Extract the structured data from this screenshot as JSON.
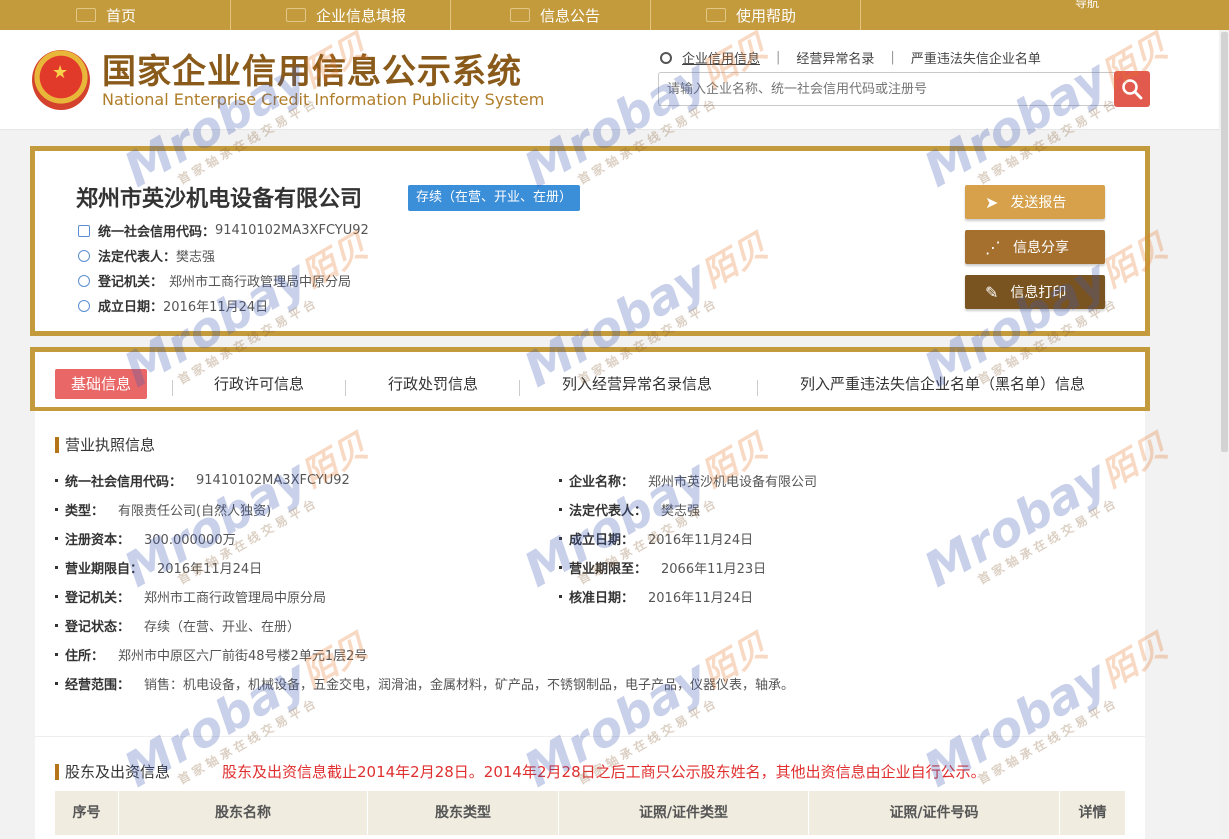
{
  "topnav": {
    "items": [
      "首页",
      "企业信息填报",
      "信息公告",
      "使用帮助"
    ],
    "right": "导航"
  },
  "header": {
    "title": "国家企业信用信息公示系统",
    "subtitle": "National Enterprise Credit Information Publicity System",
    "quicklinks": [
      "企业信用信息",
      "经营异常名录",
      "严重违法失信企业名单"
    ],
    "search_placeholder": "请输入企业名称、统一社会信用代码或注册号"
  },
  "company": {
    "name": "郑州市英沙机电设备有限公司",
    "status": "存续（在营、开业、在册）",
    "credit_code_label": "统一社会信用代码：",
    "credit_code": "91410102MA3XFCYU92",
    "legal_rep_label": "法定代表人：",
    "legal_rep": "樊志强",
    "authority_label": "登记机关：",
    "authority": "郑州市工商行政管理局中原分局",
    "founded_label": "成立日期：",
    "founded": "2016年11月24日"
  },
  "actions": [
    "发送报告",
    "信息分享",
    "信息打印"
  ],
  "tabs": [
    "基础信息",
    "行政许可信息",
    "行政处罚信息",
    "列入经营异常名录信息",
    "列入严重违法失信企业名单（黑名单）信息"
  ],
  "license": {
    "title": "营业执照信息",
    "fields": [
      {
        "k": "统一社会信用代码：",
        "v": "91410102MA3XFCYU92"
      },
      {
        "k": "企业名称：",
        "v": "郑州市英沙机电设备有限公司"
      },
      {
        "k": "类型：",
        "v": "有限责任公司(自然人独资)"
      },
      {
        "k": "法定代表人：",
        "v": "樊志强"
      },
      {
        "k": "注册资本：",
        "v": "300.000000万"
      },
      {
        "k": "成立日期：",
        "v": "2016年11月24日"
      },
      {
        "k": "营业期限自：",
        "v": "2016年11月24日"
      },
      {
        "k": "营业期限至：",
        "v": "2066年11月23日"
      },
      {
        "k": "登记机关：",
        "v": "郑州市工商行政管理局中原分局"
      },
      {
        "k": "核准日期：",
        "v": "2016年11月24日"
      },
      {
        "k": "登记状态：",
        "v": "存续（在营、开业、在册）"
      },
      {
        "k": "住所：",
        "v": "郑州市中原区六厂前街48号楼2单元1层2号"
      },
      {
        "k": "经营范围：",
        "v": "销售：机电设备，机械设备，五金交电，润滑油，金属材料，矿产品，不锈钢制品，电子产品，仪器仪表，轴承。"
      }
    ]
  },
  "shareholders": {
    "title": "股东及出资信息",
    "notice": "股东及出资信息截止2014年2月28日。2014年2月28日之后工商只公示股东姓名，其他出资信息由企业自行公示。",
    "columns": [
      "序号",
      "股东名称",
      "股东类型",
      "证照/证件类型",
      "证照/证件号码",
      "详情"
    ]
  },
  "watermark": {
    "text": "Mrobay",
    "cn": "陌贝",
    "sub": "首家轴承在线交易平台"
  }
}
